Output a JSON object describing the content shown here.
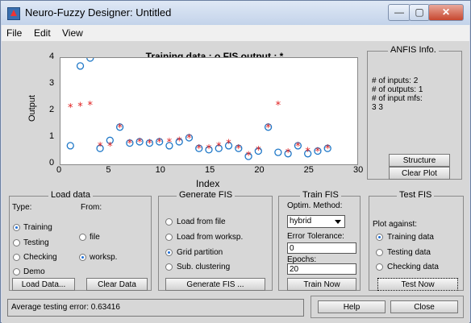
{
  "window": {
    "title": "Neuro-Fuzzy Designer: Untitled",
    "minimize": "—",
    "maximize": "▢",
    "close": "✕"
  },
  "menu": {
    "file": "File",
    "edit": "Edit",
    "view": "View"
  },
  "plot": {
    "title": "Training data : o   FIS output : *",
    "ylabel": "Output",
    "xlabel": "Index",
    "yticks": [
      "0",
      "1",
      "2",
      "3",
      "4"
    ],
    "xticks": [
      "0",
      "5",
      "10",
      "15",
      "20",
      "25",
      "30"
    ]
  },
  "chart_data": {
    "type": "scatter",
    "xlim": [
      0,
      30
    ],
    "ylim": [
      0,
      4
    ],
    "training": [
      [
        1,
        0.7
      ],
      [
        2,
        3.7
      ],
      [
        3,
        4.0
      ],
      [
        4,
        0.6
      ],
      [
        5,
        0.9
      ],
      [
        6,
        1.4
      ],
      [
        7,
        0.8
      ],
      [
        8,
        0.85
      ],
      [
        9,
        0.8
      ],
      [
        10,
        0.85
      ],
      [
        11,
        0.7
      ],
      [
        12,
        0.85
      ],
      [
        13,
        1.0
      ],
      [
        14,
        0.6
      ],
      [
        15,
        0.55
      ],
      [
        16,
        0.6
      ],
      [
        17,
        0.7
      ],
      [
        18,
        0.6
      ],
      [
        19,
        0.3
      ],
      [
        20,
        0.5
      ],
      [
        21,
        1.4
      ],
      [
        22,
        0.45
      ],
      [
        23,
        0.4
      ],
      [
        24,
        0.7
      ],
      [
        25,
        0.4
      ],
      [
        26,
        0.5
      ],
      [
        27,
        0.6
      ]
    ],
    "fis_output": [
      [
        1,
        2.15
      ],
      [
        2,
        2.2
      ],
      [
        3,
        2.25
      ],
      [
        4,
        0.7
      ],
      [
        5,
        0.7
      ],
      [
        6,
        1.4
      ],
      [
        7,
        0.8
      ],
      [
        8,
        0.85
      ],
      [
        9,
        0.8
      ],
      [
        10,
        0.85
      ],
      [
        11,
        0.85
      ],
      [
        12,
        0.9
      ],
      [
        13,
        1.0
      ],
      [
        14,
        0.6
      ],
      [
        15,
        0.6
      ],
      [
        16,
        0.7
      ],
      [
        17,
        0.8
      ],
      [
        18,
        0.6
      ],
      [
        19,
        0.35
      ],
      [
        20,
        0.55
      ],
      [
        21,
        1.4
      ],
      [
        22,
        2.25
      ],
      [
        23,
        0.45
      ],
      [
        24,
        0.7
      ],
      [
        25,
        0.5
      ],
      [
        26,
        0.5
      ],
      [
        27,
        0.6
      ]
    ]
  },
  "anfis": {
    "title": "ANFIS Info.",
    "inputs": "# of inputs: 2",
    "outputs": "# of outputs: 1",
    "mfs": "# of input mfs:",
    "mfs_values": "3  3",
    "structure_button": "Structure",
    "clear_plot_button": "Clear Plot"
  },
  "load_data": {
    "title": "Load data",
    "type_label": "Type:",
    "from_label": "From:",
    "training": "Training",
    "testing": "Testing",
    "checking": "Checking",
    "demo": "Demo",
    "file": "file",
    "worksp": "worksp.",
    "load_button": "Load Data...",
    "clear_button": "Clear Data"
  },
  "generate_fis": {
    "title": "Generate FIS",
    "opt1": "Load from file",
    "opt2": "Load from worksp.",
    "opt3": "Grid partition",
    "opt4": "Sub. clustering",
    "button": "Generate FIS ..."
  },
  "train_fis": {
    "title": "Train FIS",
    "optim_label": "Optim. Method:",
    "method": "hybrid",
    "error_label": "Error Tolerance:",
    "error_value": "0",
    "epochs_label": "Epochs:",
    "epochs_value": "20",
    "button": "Train Now"
  },
  "test_fis": {
    "title": "Test FIS",
    "plot_against": "Plot against:",
    "opt1": "Training data",
    "opt2": "Testing data",
    "opt3": "Checking data",
    "button": "Test Now"
  },
  "status": {
    "text": "Average testing error: 0.63416"
  },
  "bottom": {
    "help": "Help",
    "close": "Close"
  },
  "colors": {
    "training_marker": "#1f78c8",
    "fis_marker": "#e02020"
  }
}
